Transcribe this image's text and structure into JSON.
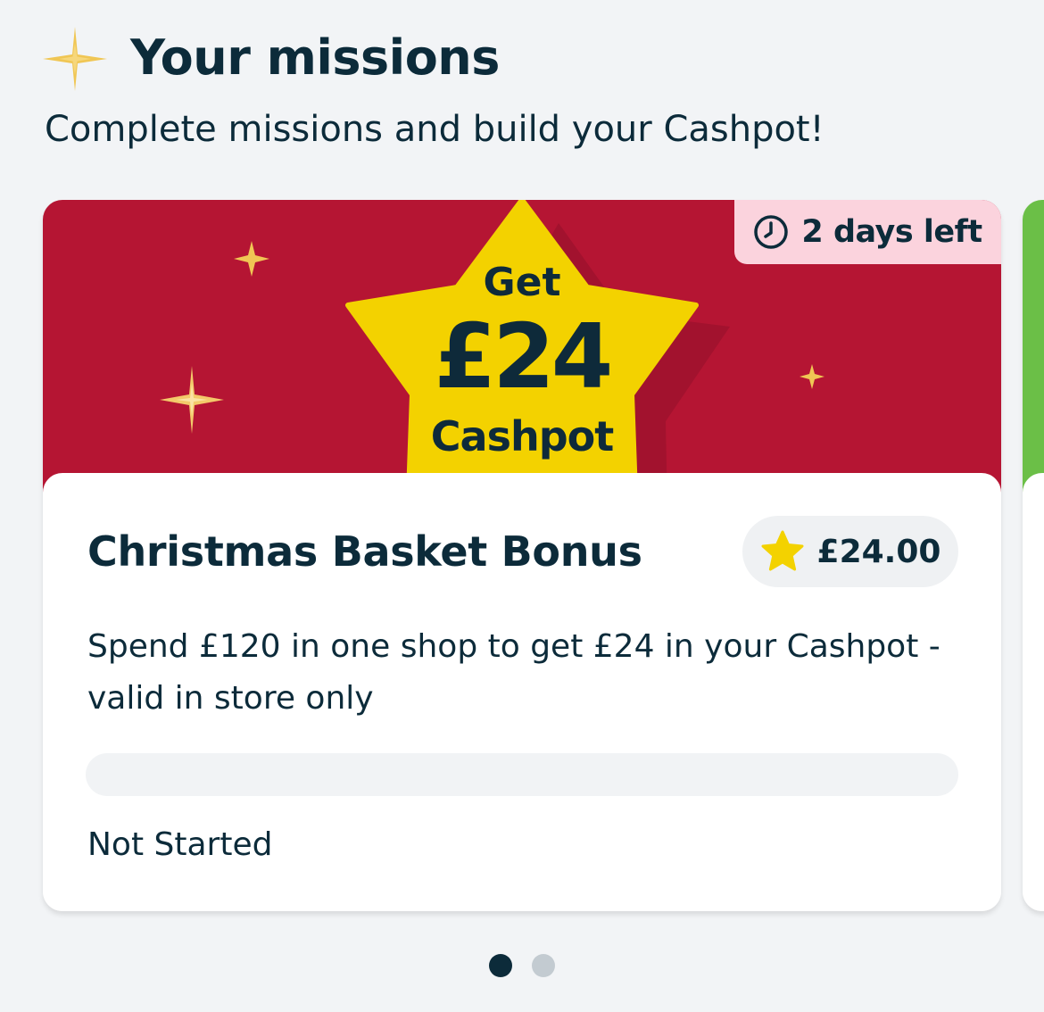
{
  "header": {
    "title": "Your missions",
    "subtitle": "Complete missions and build your Cashpot!",
    "icon": "sparkle-icon"
  },
  "mission_card": {
    "banner": {
      "color": "#b51533",
      "star_color": "#f3d200",
      "get_label": "Get",
      "amount_label": "£24",
      "cashpot_label": "Cashpot"
    },
    "time_badge": {
      "icon": "clock-icon",
      "label": "2 days left",
      "color": "#fbd3dd"
    },
    "title": "Christmas Basket Bonus",
    "reward": {
      "icon": "star-icon",
      "label": "£24.00"
    },
    "description": "Spend £120 in one shop to get £24 in your Cashpot - valid in store only",
    "progress": 0,
    "status": "Not Started"
  },
  "next_card": {
    "accent_color": "#6bbf47"
  },
  "pagination": {
    "count": 2,
    "active": 0
  },
  "colors": {
    "background": "#f2f4f6",
    "text": "#0c2b3a",
    "gold": "#f0c654",
    "dot_active": "#0c2b3a",
    "dot_inactive": "#c3cbd1"
  }
}
